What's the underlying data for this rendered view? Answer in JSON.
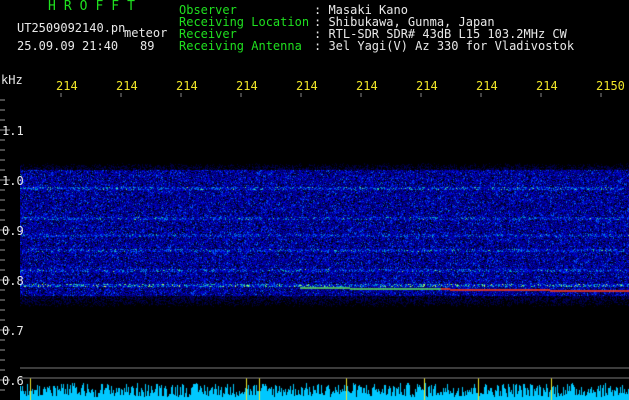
{
  "header": {
    "brand": "HROFFT",
    "filename": "UT2509092140.pn",
    "filename_suffix": "meteor",
    "datetime": "25.09.09 21:40",
    "y_position": "89",
    "info": [
      {
        "key": "Observer",
        "value": ": Masaki Kano"
      },
      {
        "key": "Receiving Location",
        "value": ": Shibukawa, Gunma, Japan"
      },
      {
        "key": "Receiver",
        "value": ": RTL-SDR SDR# 43dB L15 103.2MHz CW"
      },
      {
        "key": "Receiving Antenna",
        "value": ": 3el Yagi(V) Az 330 for Vladivostok"
      }
    ]
  },
  "axis": {
    "y_unit": "kHz",
    "x_ticks": [
      "214",
      "214",
      "214",
      "214",
      "214",
      "214",
      "214",
      "214",
      "214",
      "2150"
    ],
    "y_ticks": [
      "1.1",
      "1.0",
      "0.9",
      "0.8",
      "0.7",
      "0.6"
    ]
  },
  "colors": {
    "header_label": "#1fe01f",
    "header_value": "#e8e8e8",
    "tick_label": "#f0e628",
    "spectrogram_base": "#0a1a9c",
    "bottom_strip": "#00c8ff"
  }
}
